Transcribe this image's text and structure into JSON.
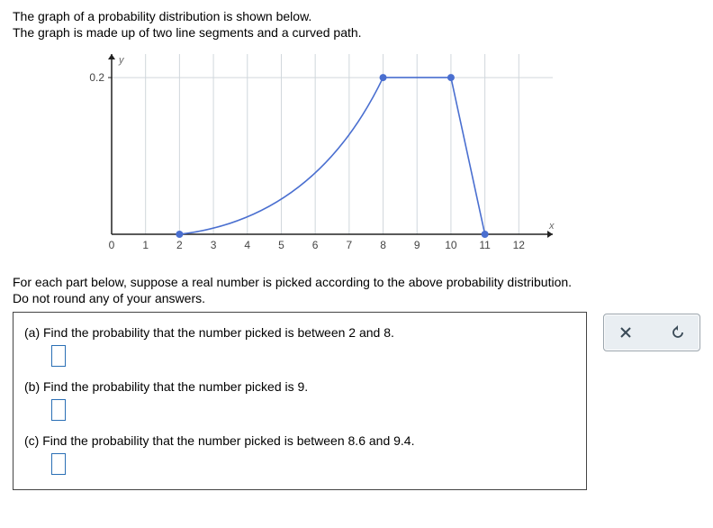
{
  "intro": {
    "line1": "The graph of a probability distribution is shown below.",
    "line2": "The graph is made up of two line segments and a curved path."
  },
  "chart_data": {
    "type": "line",
    "title": "",
    "xlabel": "x",
    "ylabel": "y",
    "xlim": [
      0,
      13
    ],
    "ylim": [
      0,
      0.23
    ],
    "xticks": [
      0,
      1,
      2,
      3,
      4,
      5,
      6,
      7,
      8,
      9,
      10,
      11,
      12
    ],
    "yticks": [
      0.2
    ],
    "segments": [
      {
        "kind": "curve",
        "from": {
          "x": 2,
          "y": 0
        },
        "to": {
          "x": 8,
          "y": 0.2
        },
        "control": {
          "x": 6,
          "y": 0.02
        }
      },
      {
        "kind": "line",
        "from": {
          "x": 8,
          "y": 0.2
        },
        "to": {
          "x": 10,
          "y": 0.2
        }
      },
      {
        "kind": "line",
        "from": {
          "x": 10,
          "y": 0.2
        },
        "to": {
          "x": 11,
          "y": 0
        }
      }
    ],
    "points": [
      {
        "x": 2,
        "y": 0
      },
      {
        "x": 8,
        "y": 0.2
      },
      {
        "x": 10,
        "y": 0.2
      },
      {
        "x": 11,
        "y": 0
      }
    ]
  },
  "instructions": {
    "line1": "For each part below, suppose a real number is picked according to the above probability distribution.",
    "line2": "Do not round any of your answers."
  },
  "parts": {
    "a": "(a) Find the probability that the number picked is between 2 and 8.",
    "b": "(b) Find the probability that the number picked is 9.",
    "c": "(c) Find the probability that the number picked is between 8.6 and 9.4."
  },
  "toolbar": {
    "clear_label": "✕",
    "reset_label": "↻"
  }
}
